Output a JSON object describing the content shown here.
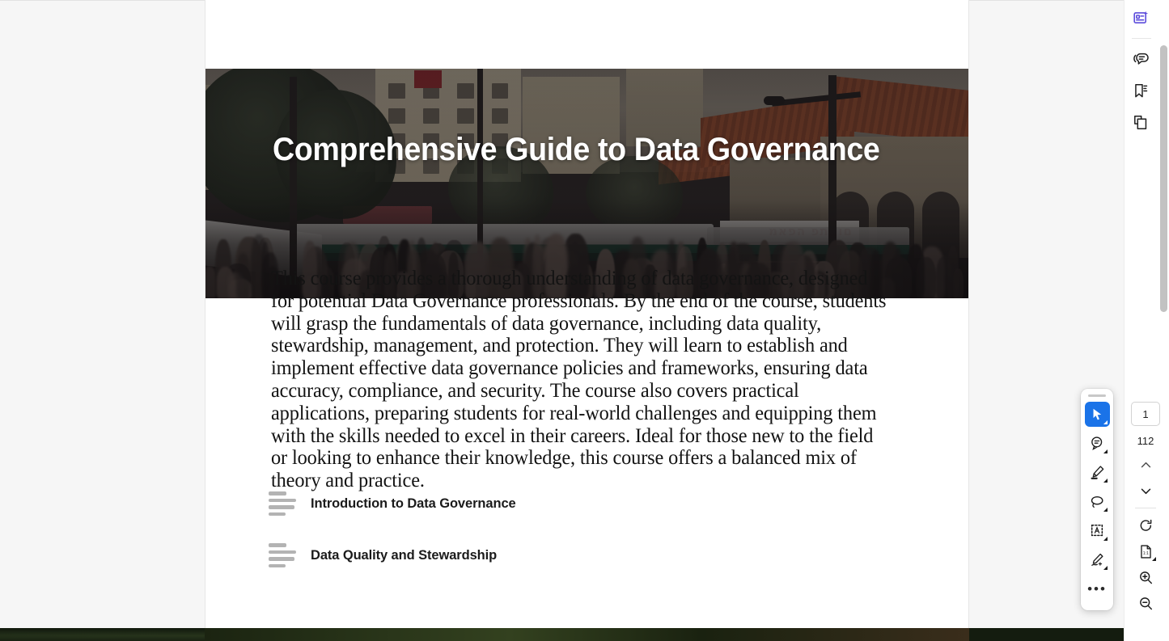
{
  "app": {
    "background_color": "#f6f6f6",
    "accent_color": "#1a73e8",
    "ai_icon_color": "#5b4bdb"
  },
  "document": {
    "hero": {
      "title": "Comprehensive Guide to Data Governance",
      "image_alt": "Crowded city street with stone buildings, terracotta roofs, trees and a tram"
    },
    "body_text": "This course provides a thorough understanding of data governance, designed for potential Data Governance professionals. By the end of the course, students will grasp the fundamentals of data governance, including data quality, stewardship, management, and protection. They will learn to establish and implement effective data governance policies and frameworks, ensuring data accuracy, compliance, and security. The course also covers practical applications, preparing students for real-world challenges and equipping them with the skills needed to excel in their careers. Ideal for those new to the field or looking to enhance their knowledge, this course offers a balanced mix of theory and practice.",
    "chapters": [
      {
        "label": "Introduction to Data Governance"
      },
      {
        "label": "Data Quality and Stewardship"
      }
    ],
    "shop_sign_text": "םואתפ הפאמ"
  },
  "right_rail": {
    "items": [
      {
        "name": "ai-summary-icon",
        "label": "AI Summary"
      },
      {
        "name": "comments-icon",
        "label": "Comments"
      },
      {
        "name": "bookmarks-icon",
        "label": "Bookmarks"
      },
      {
        "name": "thumbnails-icon",
        "label": "Page Thumbnails"
      }
    ]
  },
  "tool_palette": {
    "tools": [
      {
        "name": "select-tool",
        "label": "Select",
        "active": true,
        "has_caret": true
      },
      {
        "name": "comment-tool",
        "label": "Comment",
        "active": false,
        "has_caret": true
      },
      {
        "name": "highlight-tool",
        "label": "Highlight",
        "active": false,
        "has_caret": true
      },
      {
        "name": "lasso-tool",
        "label": "Lasso",
        "active": false,
        "has_caret": true
      },
      {
        "name": "text-select-tool",
        "label": "Text Select",
        "active": false,
        "has_caret": true
      },
      {
        "name": "signature-tool",
        "label": "Signature",
        "active": false,
        "has_caret": true
      },
      {
        "name": "more-tools",
        "label": "More",
        "active": false,
        "has_caret": false
      }
    ],
    "more_label": "•••"
  },
  "navigation": {
    "current_page": "1",
    "total_pages": "112",
    "prev_label": "Previous page",
    "next_label": "Next page",
    "rotate_label": "Rotate",
    "fit_label": "Fit page",
    "zoom_in_label": "Zoom in",
    "zoom_out_label": "Zoom out"
  }
}
